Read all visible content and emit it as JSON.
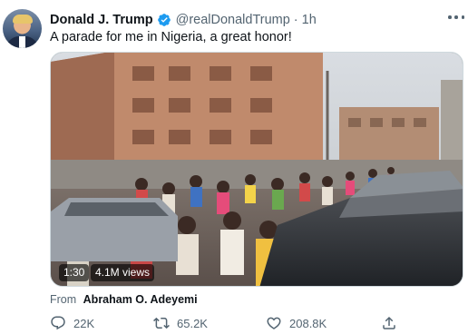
{
  "tweet": {
    "author_name": "Donald J. Trump",
    "handle": "@realDonaldTrump",
    "separator": "·",
    "time": "1h",
    "text": "A parade for me in Nigeria, a great honor!",
    "media": {
      "duration": "1:30",
      "views": "4.1M views"
    },
    "source": {
      "label": "From",
      "name": "Abraham O. Adeyemi"
    },
    "actions": {
      "replies": "22K",
      "retweets": "65.2K",
      "likes": "208.8K"
    }
  },
  "colors": {
    "text_primary": "#0f1419",
    "text_secondary": "#536471",
    "verified_blue": "#1d9bf0",
    "border": "#cfd9de"
  },
  "icons": {
    "verified": "verified-badge-icon",
    "more": "more-options-icon",
    "reply": "reply-icon",
    "retweet": "retweet-icon",
    "like": "heart-icon",
    "share": "share-icon"
  }
}
